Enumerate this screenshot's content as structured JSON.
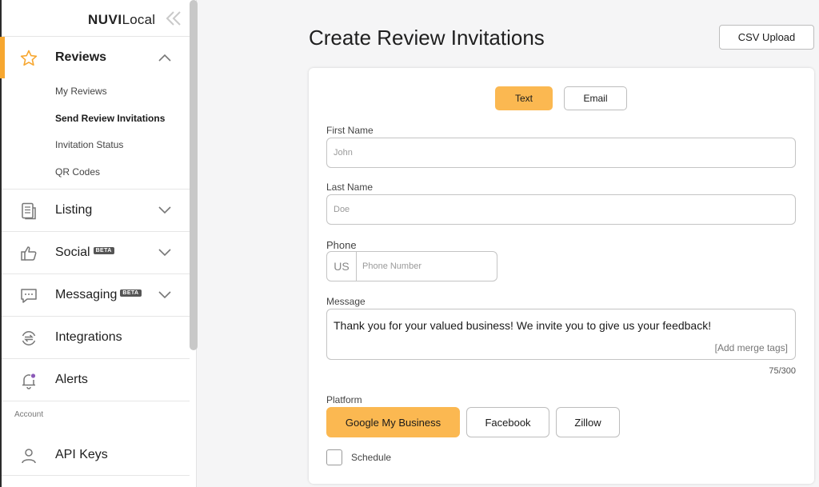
{
  "brand": {
    "logo_bold": "NUVI",
    "logo_light": "Local",
    "accent_color": "#fbb851"
  },
  "sidebar": {
    "reviews": {
      "label": "Reviews",
      "icon": "star-icon",
      "sub_items": [
        {
          "label": "My Reviews"
        },
        {
          "label": "Send Review Invitations",
          "current": true
        },
        {
          "label": "Invitation Status"
        },
        {
          "label": "QR Codes"
        }
      ]
    },
    "items": [
      {
        "label": "Listing",
        "icon": "document-icon",
        "beta": ""
      },
      {
        "label": "Social",
        "icon": "thumbs-up-icon",
        "beta": "BETA"
      },
      {
        "label": "Messaging",
        "icon": "chat-icon",
        "beta": "BETA"
      },
      {
        "label": "Integrations",
        "icon": "integrations-icon",
        "beta": ""
      },
      {
        "label": "Alerts",
        "icon": "bell-icon",
        "beta": ""
      }
    ],
    "account_label": "Account",
    "api_keys": {
      "label": "API Keys",
      "icon": "user-icon"
    }
  },
  "main": {
    "title": "Create Review Invitations",
    "csv_upload_label": "CSV Upload",
    "tabs": {
      "text": "Text",
      "email": "Email"
    },
    "first_name": {
      "label": "First Name",
      "placeholder": "John"
    },
    "last_name": {
      "label": "Last Name",
      "placeholder": "Doe"
    },
    "phone": {
      "label": "Phone",
      "country_code": "US",
      "placeholder": "Phone Number"
    },
    "message": {
      "label": "Message",
      "value": "Thank you for your valued business! We invite you to give us your feedback!",
      "merge_tags_label": "[Add merge tags]",
      "char_count": "75/300"
    },
    "platform": {
      "label": "Platform",
      "options": [
        "Google My Business",
        "Facebook",
        "Zillow"
      ],
      "selected": "Google My Business"
    },
    "schedule_label": "Schedule"
  }
}
